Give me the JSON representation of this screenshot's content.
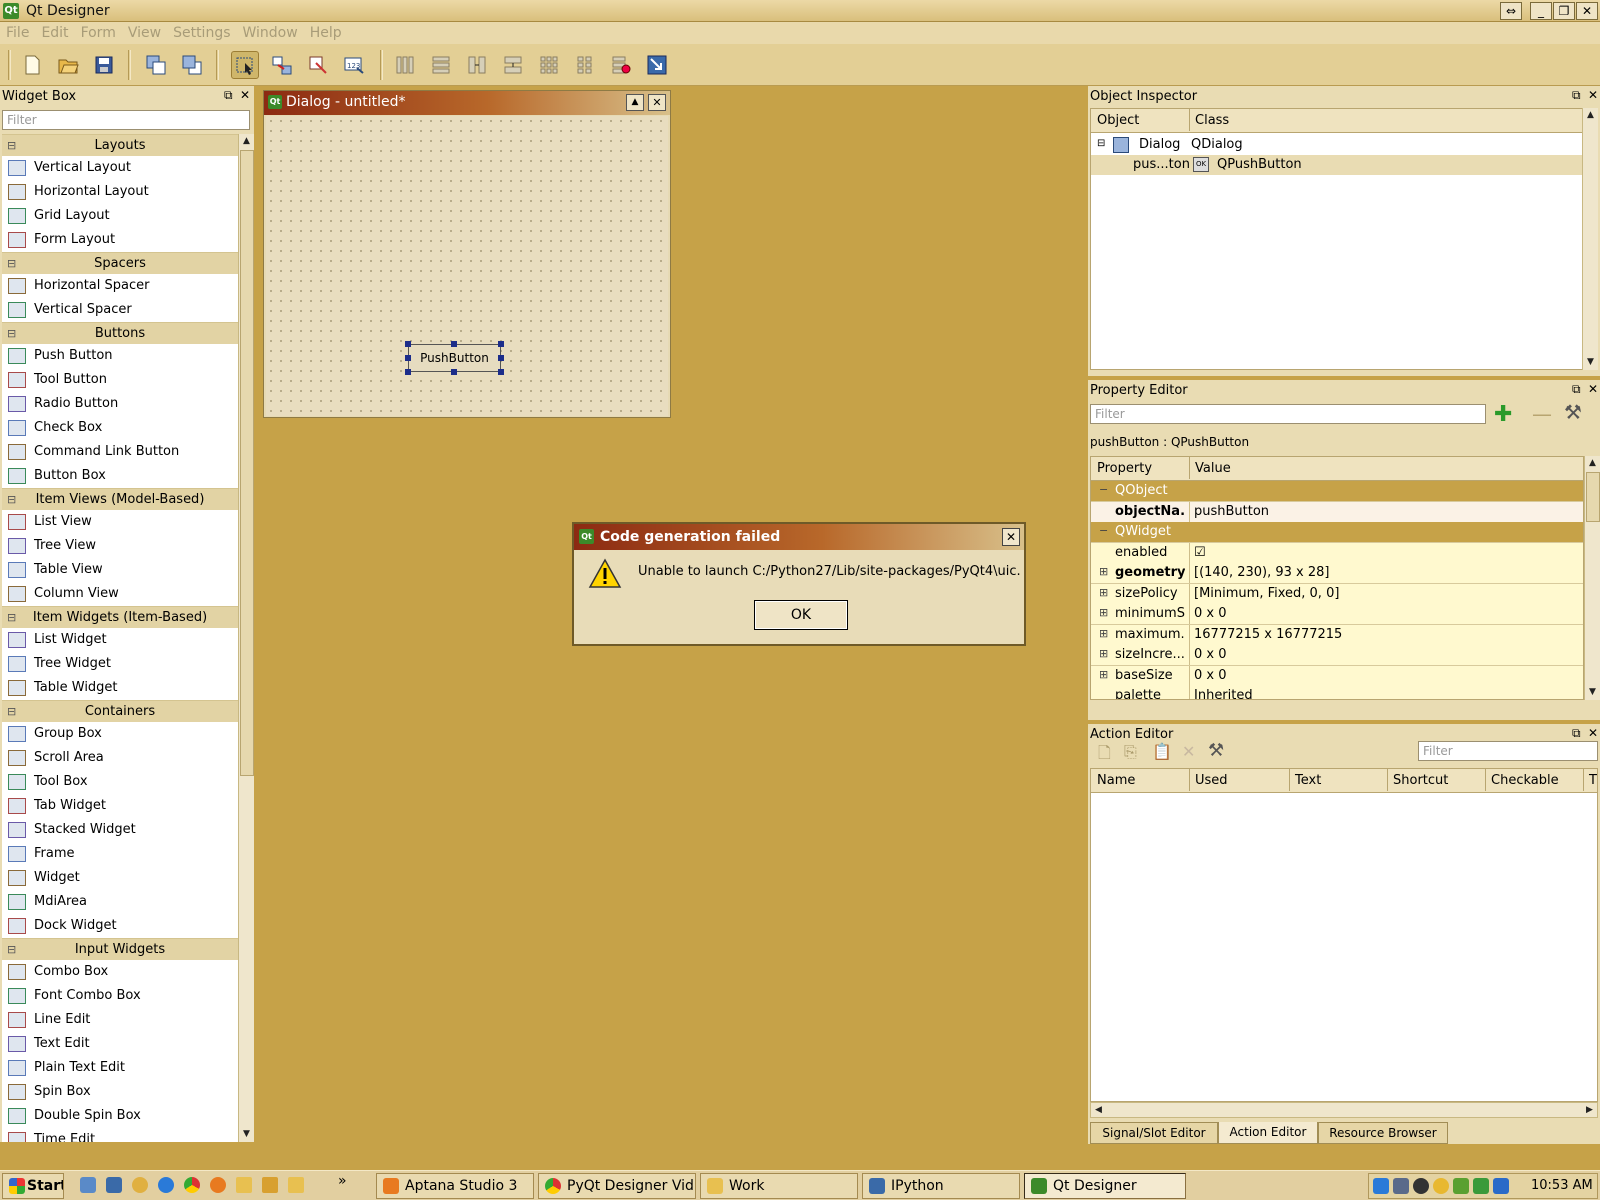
{
  "app": {
    "title": "Qt Designer"
  },
  "window_controls": {
    "restore": "⇔",
    "min": "_",
    "max": "❐",
    "close": "✕"
  },
  "menu": [
    "File",
    "Edit",
    "Form",
    "View",
    "Settings",
    "Window",
    "Help"
  ],
  "widget_box": {
    "title": "Widget Box",
    "filter_placeholder": "Filter",
    "categories": [
      {
        "name": "Layouts",
        "items": [
          "Vertical Layout",
          "Horizontal Layout",
          "Grid Layout",
          "Form Layout"
        ]
      },
      {
        "name": "Spacers",
        "items": [
          "Horizontal Spacer",
          "Vertical Spacer"
        ]
      },
      {
        "name": "Buttons",
        "items": [
          "Push Button",
          "Tool Button",
          "Radio Button",
          "Check Box",
          "Command Link Button",
          "Button Box"
        ]
      },
      {
        "name": "Item Views (Model-Based)",
        "items": [
          "List View",
          "Tree View",
          "Table View",
          "Column View"
        ]
      },
      {
        "name": "Item Widgets (Item-Based)",
        "items": [
          "List Widget",
          "Tree Widget",
          "Table Widget"
        ]
      },
      {
        "name": "Containers",
        "items": [
          "Group Box",
          "Scroll Area",
          "Tool Box",
          "Tab Widget",
          "Stacked Widget",
          "Frame",
          "Widget",
          "MdiArea",
          "Dock Widget"
        ]
      },
      {
        "name": "Input Widgets",
        "items": [
          "Combo Box",
          "Font Combo Box",
          "Line Edit",
          "Text Edit",
          "Plain Text Edit",
          "Spin Box",
          "Double Spin Box",
          "Time Edit"
        ]
      }
    ]
  },
  "form": {
    "title": "Dialog - untitled*",
    "button_label": "PushButton"
  },
  "message_box": {
    "title": "Code generation failed",
    "text": "Unable to launch C:/Python27/Lib/site-packages/PyQt4\\uic.",
    "ok": "OK"
  },
  "object_inspector": {
    "title": "Object Inspector",
    "columns": [
      "Object",
      "Class"
    ],
    "rows": [
      {
        "object": "Dialog",
        "class": "QDialog"
      },
      {
        "object": "pus...ton",
        "class": "QPushButton"
      }
    ]
  },
  "property_editor": {
    "title": "Property Editor",
    "filter_placeholder": "Filter",
    "selected": "pushButton : QPushButton",
    "columns": [
      "Property",
      "Value"
    ],
    "rows": [
      {
        "name": "QObject",
        "value": "",
        "group": true
      },
      {
        "name": "objectNa...",
        "value": "pushButton",
        "bold": true
      },
      {
        "name": "QWidget",
        "value": "",
        "group": true
      },
      {
        "name": "enabled",
        "value": "☑",
        "checkbox": true
      },
      {
        "name": "geometry",
        "value": "[(140, 230), 93 x 28]",
        "bold": true,
        "expand": true
      },
      {
        "name": "sizePolicy",
        "value": "[Minimum, Fixed, 0, 0]",
        "expand": true
      },
      {
        "name": "minimumS...",
        "value": "0 x 0",
        "expand": true
      },
      {
        "name": "maximum...",
        "value": "16777215 x 16777215",
        "expand": true
      },
      {
        "name": "sizeIncre...",
        "value": "0 x 0",
        "expand": true
      },
      {
        "name": "baseSize",
        "value": "0 x 0",
        "expand": true
      },
      {
        "name": "palette",
        "value": "Inherited"
      }
    ]
  },
  "action_editor": {
    "title": "Action Editor",
    "filter_placeholder": "Filter",
    "columns": [
      "Name",
      "Used",
      "Text",
      "Shortcut",
      "Checkable",
      "T"
    ]
  },
  "bottom_tabs": [
    "Signal/Slot Editor",
    "Action Editor",
    "Resource Browser"
  ],
  "taskbar": {
    "start": "Start",
    "overflow": "»",
    "windows": [
      "Aptana Studio 3",
      "PyQt Designer Vid...",
      "Work",
      "IPython",
      "Qt Designer"
    ],
    "clock": "10:53 AM"
  },
  "colors": {
    "accent": "#c6a248",
    "titlebar_dark": "#8c2a12"
  }
}
